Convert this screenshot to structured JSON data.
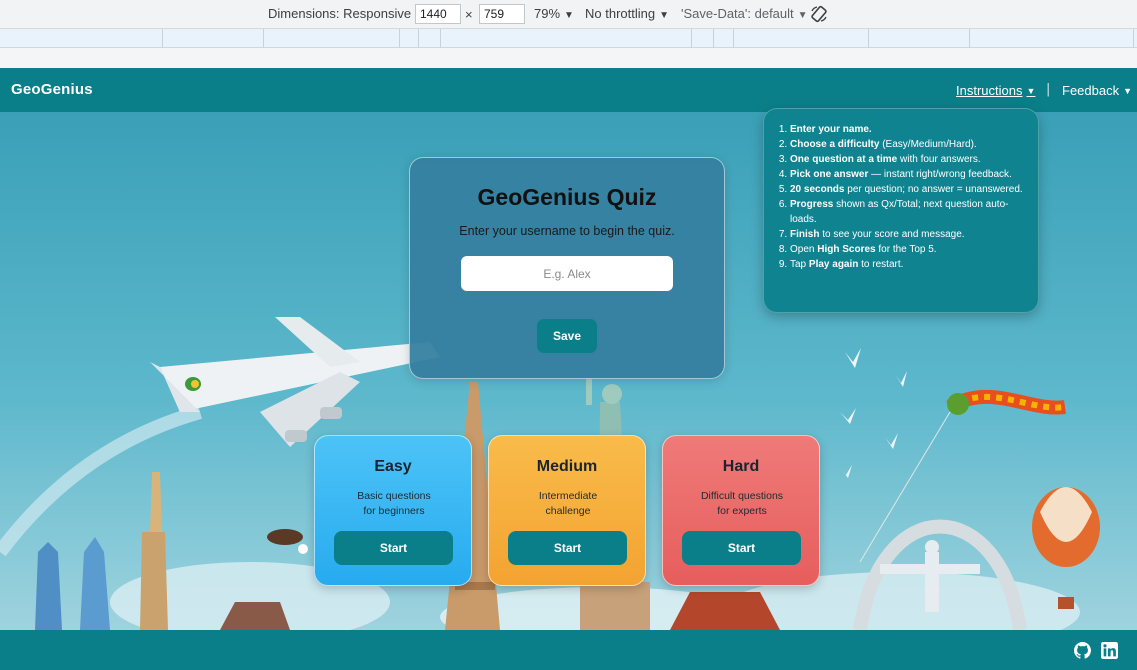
{
  "devtools": {
    "dimensions_label": "Dimensions: Responsive",
    "width_value": "1440",
    "times": "×",
    "height_value": "759",
    "zoom": "79%",
    "throttling": "No throttling",
    "save_data": "'Save-Data': default"
  },
  "navbar": {
    "brand": "GeoGenius",
    "instructions_label": "Instructions",
    "separator": "|",
    "feedback_label": "Feedback"
  },
  "instructions": [
    {
      "bold": "Enter your name.",
      "rest": ""
    },
    {
      "bold": "Choose a difficulty",
      "rest": " (Easy/Medium/Hard)."
    },
    {
      "bold": "One question at a time",
      "rest": " with four answers."
    },
    {
      "bold": "Pick one answer",
      "rest": " — instant right/wrong feedback."
    },
    {
      "bold": "20 seconds",
      "rest": " per question; no answer = unanswered."
    },
    {
      "bold": "Progress",
      "rest": " shown as Qx/Total; next question auto-loads."
    },
    {
      "bold": "Finish",
      "rest": " to see your score and message."
    },
    {
      "pre": "Open ",
      "bold": "High Scores",
      "rest": " for the Top 5."
    },
    {
      "pre": "Tap ",
      "bold": "Play again",
      "rest": " to restart."
    }
  ],
  "quiz": {
    "title": "GeoGenius Quiz",
    "subtitle": "Enter your username to begin the quiz.",
    "username_placeholder": "E.g. Alex",
    "username_value": "",
    "save_label": "Save"
  },
  "difficulties": [
    {
      "name": "Easy",
      "desc_line1": "Basic questions",
      "desc_line2": "for beginners",
      "button": "Start"
    },
    {
      "name": "Medium",
      "desc_line1": "Intermediate",
      "desc_line2": "challenge",
      "button": "Start"
    },
    {
      "name": "Hard",
      "desc_line1": "Difficult questions",
      "desc_line2": "for experts",
      "button": "Start"
    }
  ],
  "footer": {
    "icons": [
      "github-icon",
      "linkedin-icon"
    ]
  },
  "colors": {
    "brand_teal": "#0b7f89",
    "easy": "#3bb8f3",
    "medium": "#f6af3d",
    "hard": "#ea6b6a"
  }
}
